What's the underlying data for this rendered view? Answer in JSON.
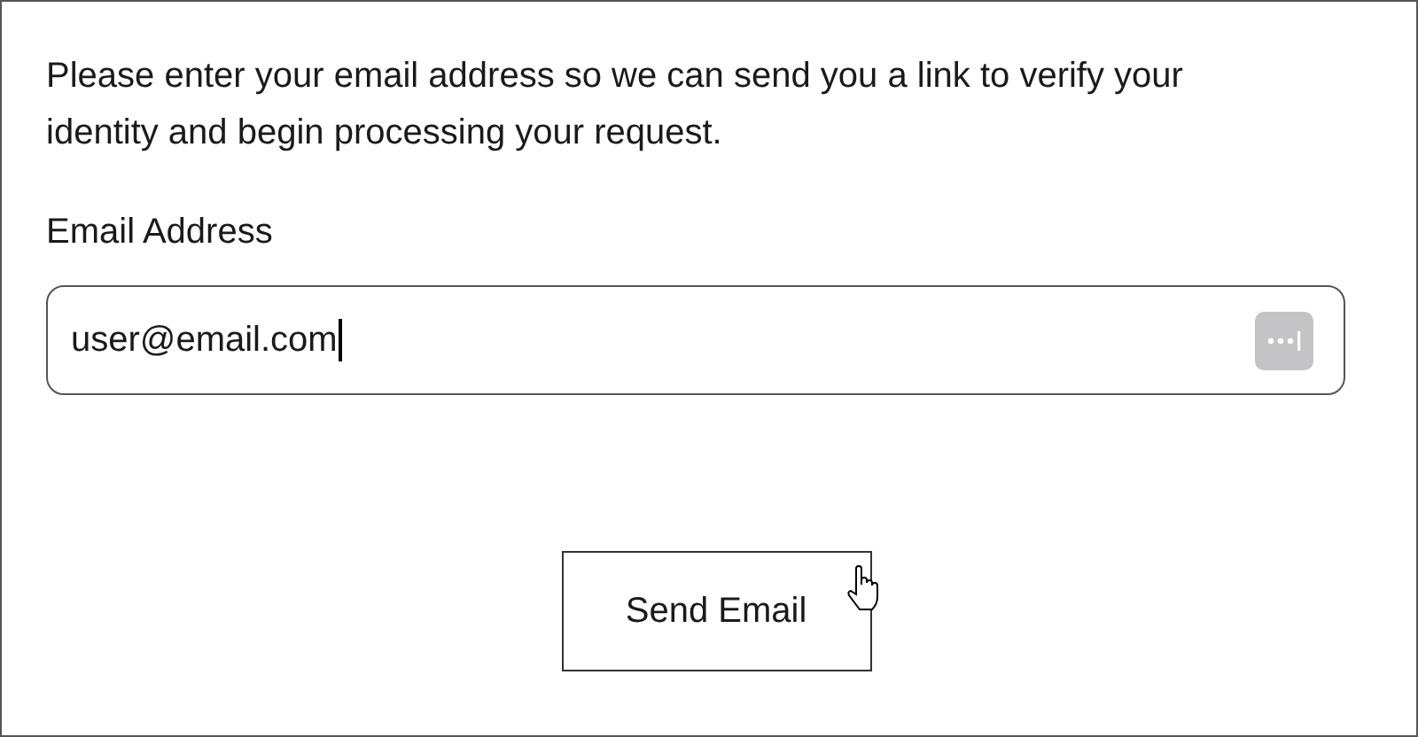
{
  "instructions": "Please enter your email address so we can send you a link to verify your identity and begin processing your request.",
  "email_field": {
    "label": "Email Address",
    "value": "user@email.com",
    "focused": true
  },
  "send_button": {
    "label": "Send Email",
    "hovered": true
  }
}
